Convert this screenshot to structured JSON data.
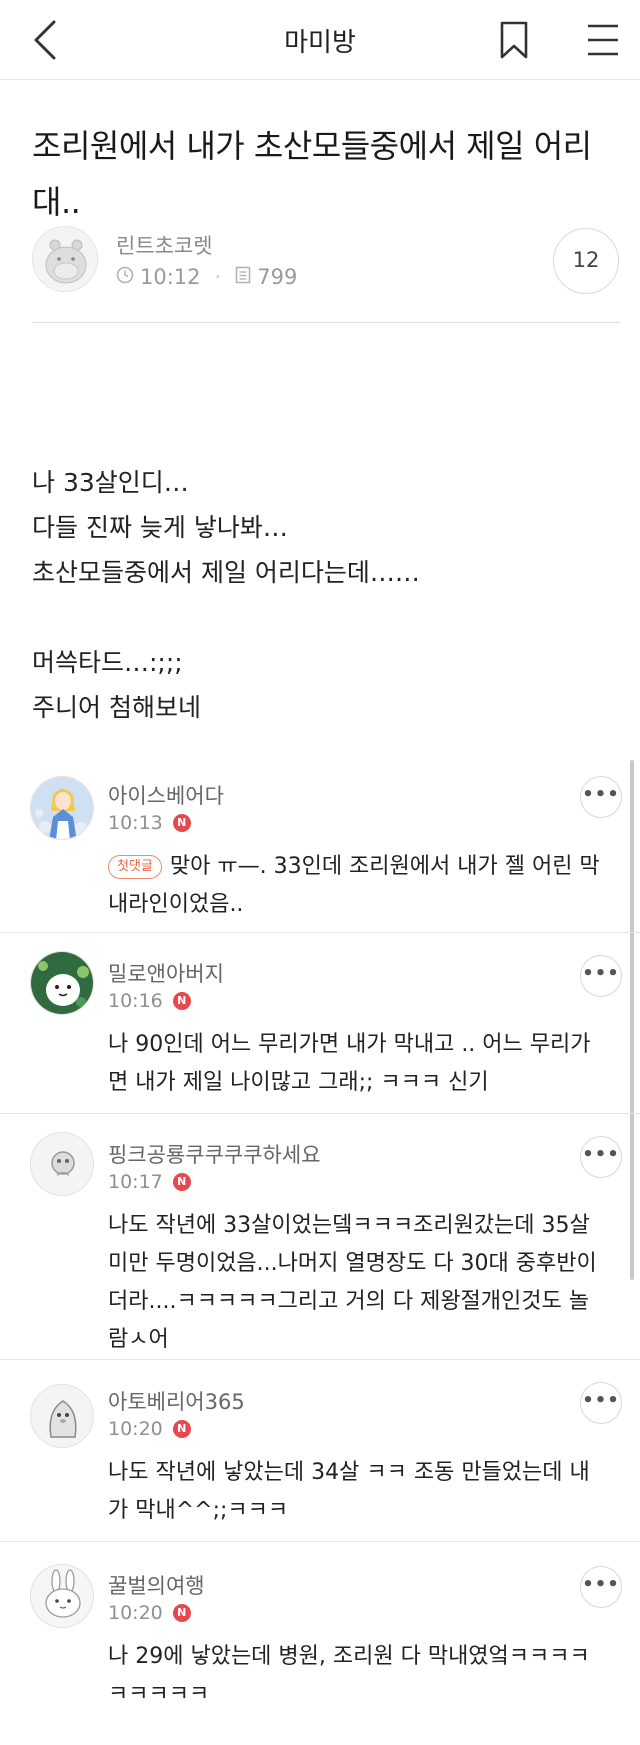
{
  "header": {
    "title": "마미방"
  },
  "post": {
    "title": "조리원에서 내가 초산모들중에서 제일 어리대..",
    "author": "린트초코렛",
    "time": "10:12",
    "views": "799",
    "comment_count": "12",
    "body": [
      "나 33살인디…",
      "다들 진짜 늦게 낳나봐…",
      "초산모들중에서 제일 어리다는데……",
      "",
      "머쓱타드…:;;;",
      "주니어 첨해보네"
    ]
  },
  "comments": [
    {
      "name": "아이스베어다",
      "time": "10:13",
      "badge": "N",
      "first_tag": "첫댓글",
      "text": "맞아 ㅠ—.  33인데 조리원에서 내가 젤 어린 막내라인이었음.."
    },
    {
      "name": "밀로앤아버지",
      "time": "10:16",
      "badge": "N",
      "text": "나 90인데 어느 무리가면 내가 막내고 .. 어느 무리가면 내가 제일 나이많고 그래;; ㅋㅋㅋ 신기"
    },
    {
      "name": "핑크공룡쿠쿠쿠쿠하세요",
      "time": "10:17",
      "badge": "N",
      "text": "나도 작년에 33살이었는뎈ㅋㅋㅋ조리원갔는데 35살미만 두명이었음...나머지 열명장도 다 30대 중후반이더라....ㅋㅋㅋㅋㅋ그리고 거의 다 제왕절개인것도 놀람ㅅ어"
    },
    {
      "name": "아토베리어365",
      "time": "10:20",
      "badge": "N",
      "text": "나도 작년에 낳았는데 34살 ㅋㅋ 조동 만들었는데 내가 막내^^;;ㅋㅋㅋ"
    },
    {
      "name": "꿀벌의여행",
      "time": "10:20",
      "badge": "N",
      "text": "나 29에 낳았는데 병원, 조리원 다 막내였엌ㅋㅋㅋㅋㅋㅋㅋㅋㅋ"
    }
  ],
  "icons": {
    "back": "chevron-left-icon",
    "bookmark": "bookmark-icon",
    "menu": "hamburger-menu-icon",
    "clock": "clock-icon",
    "views": "document-icon",
    "more": "more-dots-icon"
  },
  "colors": {
    "new_badge": "#e5484d",
    "first_tag": "#e5684a",
    "divider": "#e6e6e6"
  }
}
